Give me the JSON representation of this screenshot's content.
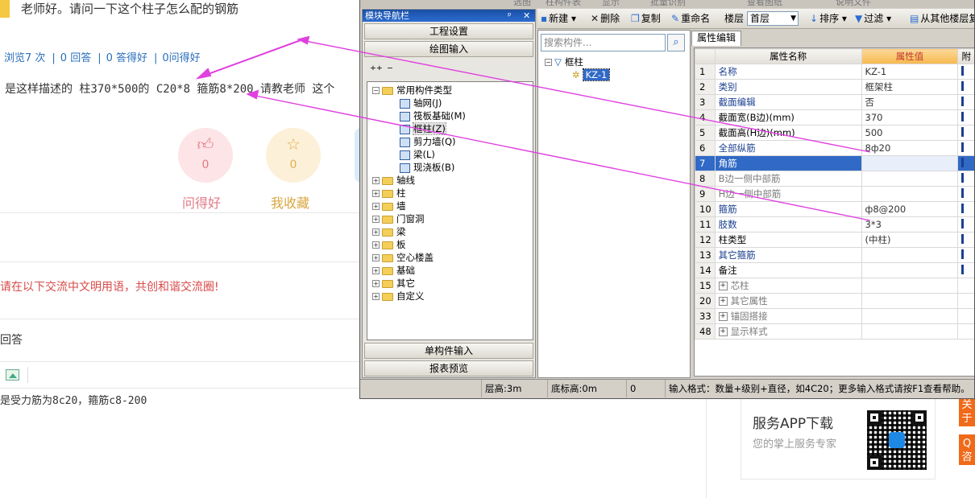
{
  "page": {
    "question_title": "老师好。请问一下这个柱子怎么配的钢筋",
    "stats": [
      "浏览7 次",
      "0 回答",
      "0 答得好",
      "0问得好"
    ],
    "description": "是这样描述的  柱370*500的 C20*8 箍筋8*200  请教老师 这个",
    "actions": {
      "like_count": "0",
      "fav_count": "0",
      "like_label": "问得好",
      "fav_label": "我收藏"
    },
    "notice": "请在以下交流中文明用语，共创和谐交流圈!",
    "answer_label": "回答",
    "answer_text": "是受力筋为8c20，箍筋c8-200",
    "app_download": {
      "title": "服务APP下载",
      "subtitle": "您的掌上服务专家"
    },
    "side_buttons": [
      "关于我",
      "Q咨"
    ]
  },
  "app": {
    "ghost_toolbar": [
      "选图",
      "柱构件表",
      "显示",
      "批量识别",
      "查看图纸",
      "说明文件"
    ],
    "nav": {
      "title": "模块导航栏",
      "buttons_top": [
        "工程设置",
        "绘图输入"
      ],
      "buttons_bottom": [
        "单构件输入",
        "报表预览"
      ],
      "tree": [
        {
          "label": "常用构件类型",
          "expanded": true,
          "children": [
            {
              "label": "轴网(J)",
              "icon": "axis-grid-icon"
            },
            {
              "label": "筏板基础(M)",
              "icon": "raft-foundation-icon"
            },
            {
              "label": "框柱(Z)",
              "icon": "frame-column-icon",
              "selected": true
            },
            {
              "label": "剪力墙(Q)",
              "icon": "shear-wall-icon"
            },
            {
              "label": "梁(L)",
              "icon": "beam-icon"
            },
            {
              "label": "现浇板(B)",
              "icon": "cast-slab-icon"
            }
          ]
        },
        {
          "label": "轴线"
        },
        {
          "label": "柱"
        },
        {
          "label": "墙"
        },
        {
          "label": "门窗洞"
        },
        {
          "label": "梁"
        },
        {
          "label": "板"
        },
        {
          "label": "空心楼盖"
        },
        {
          "label": "基础"
        },
        {
          "label": "其它"
        },
        {
          "label": "自定义"
        }
      ]
    },
    "toolbar": {
      "new": "新建",
      "delete": "删除",
      "copy": "复制",
      "rename": "重命名",
      "floor_label": "楼层",
      "floor_value": "首层",
      "sort": "排序",
      "filter": "过滤",
      "copy_from": "从其他楼层复"
    },
    "components": {
      "search_placeholder": "搜索构件...",
      "group": "框柱",
      "item": "KZ-1"
    },
    "props": {
      "tab": "属性编辑",
      "headers": [
        "属性名称",
        "属性值",
        "附"
      ],
      "rows": [
        {
          "n": "1",
          "name": "名称",
          "value": "KZ-1",
          "style": "blue"
        },
        {
          "n": "2",
          "name": "类别",
          "value": "框架柱",
          "style": "blue"
        },
        {
          "n": "3",
          "name": "截面编辑",
          "value": "否",
          "style": "blue"
        },
        {
          "n": "4",
          "name": "截面宽(B边)(mm)",
          "value": "370",
          "style": "black"
        },
        {
          "n": "5",
          "name": "截面高(H边)(mm)",
          "value": "500",
          "style": "black"
        },
        {
          "n": "6",
          "name": "全部纵筋",
          "value": "8ф20",
          "style": "blue"
        },
        {
          "n": "7",
          "name": "角筋",
          "value": "",
          "style": "blue",
          "selected": true
        },
        {
          "n": "8",
          "name": "B边一侧中部筋",
          "value": "",
          "style": "gray"
        },
        {
          "n": "9",
          "name": "H边一侧中部筋",
          "value": "",
          "style": "gray"
        },
        {
          "n": "10",
          "name": "箍筋",
          "value": "ф8@200",
          "style": "blue"
        },
        {
          "n": "11",
          "name": "肢数",
          "value": "3*3",
          "style": "blue"
        },
        {
          "n": "12",
          "name": "柱类型",
          "value": "(中柱)",
          "style": "black"
        },
        {
          "n": "13",
          "name": "其它箍筋",
          "value": "",
          "style": "blue"
        },
        {
          "n": "14",
          "name": "备注",
          "value": "",
          "style": "black"
        },
        {
          "n": "15",
          "name": "芯柱",
          "value": "",
          "style": "gray",
          "group": true
        },
        {
          "n": "20",
          "name": "其它属性",
          "value": "",
          "style": "gray",
          "group": true
        },
        {
          "n": "33",
          "name": "锚固搭接",
          "value": "",
          "style": "gray",
          "group": true
        },
        {
          "n": "48",
          "name": "显示样式",
          "value": "",
          "style": "gray",
          "group": true
        }
      ]
    },
    "status": {
      "floor_height": "层高:3m",
      "base_elev": "底标高:0m",
      "count": "0",
      "hint": "输入格式：数量+级别+直径，如4C20；更多输入格式请按F1查看帮助。"
    },
    "colors": {
      "arrow": "#e040e0",
      "selection": "#3169c6",
      "nav_header": "#1a4fa5"
    }
  }
}
